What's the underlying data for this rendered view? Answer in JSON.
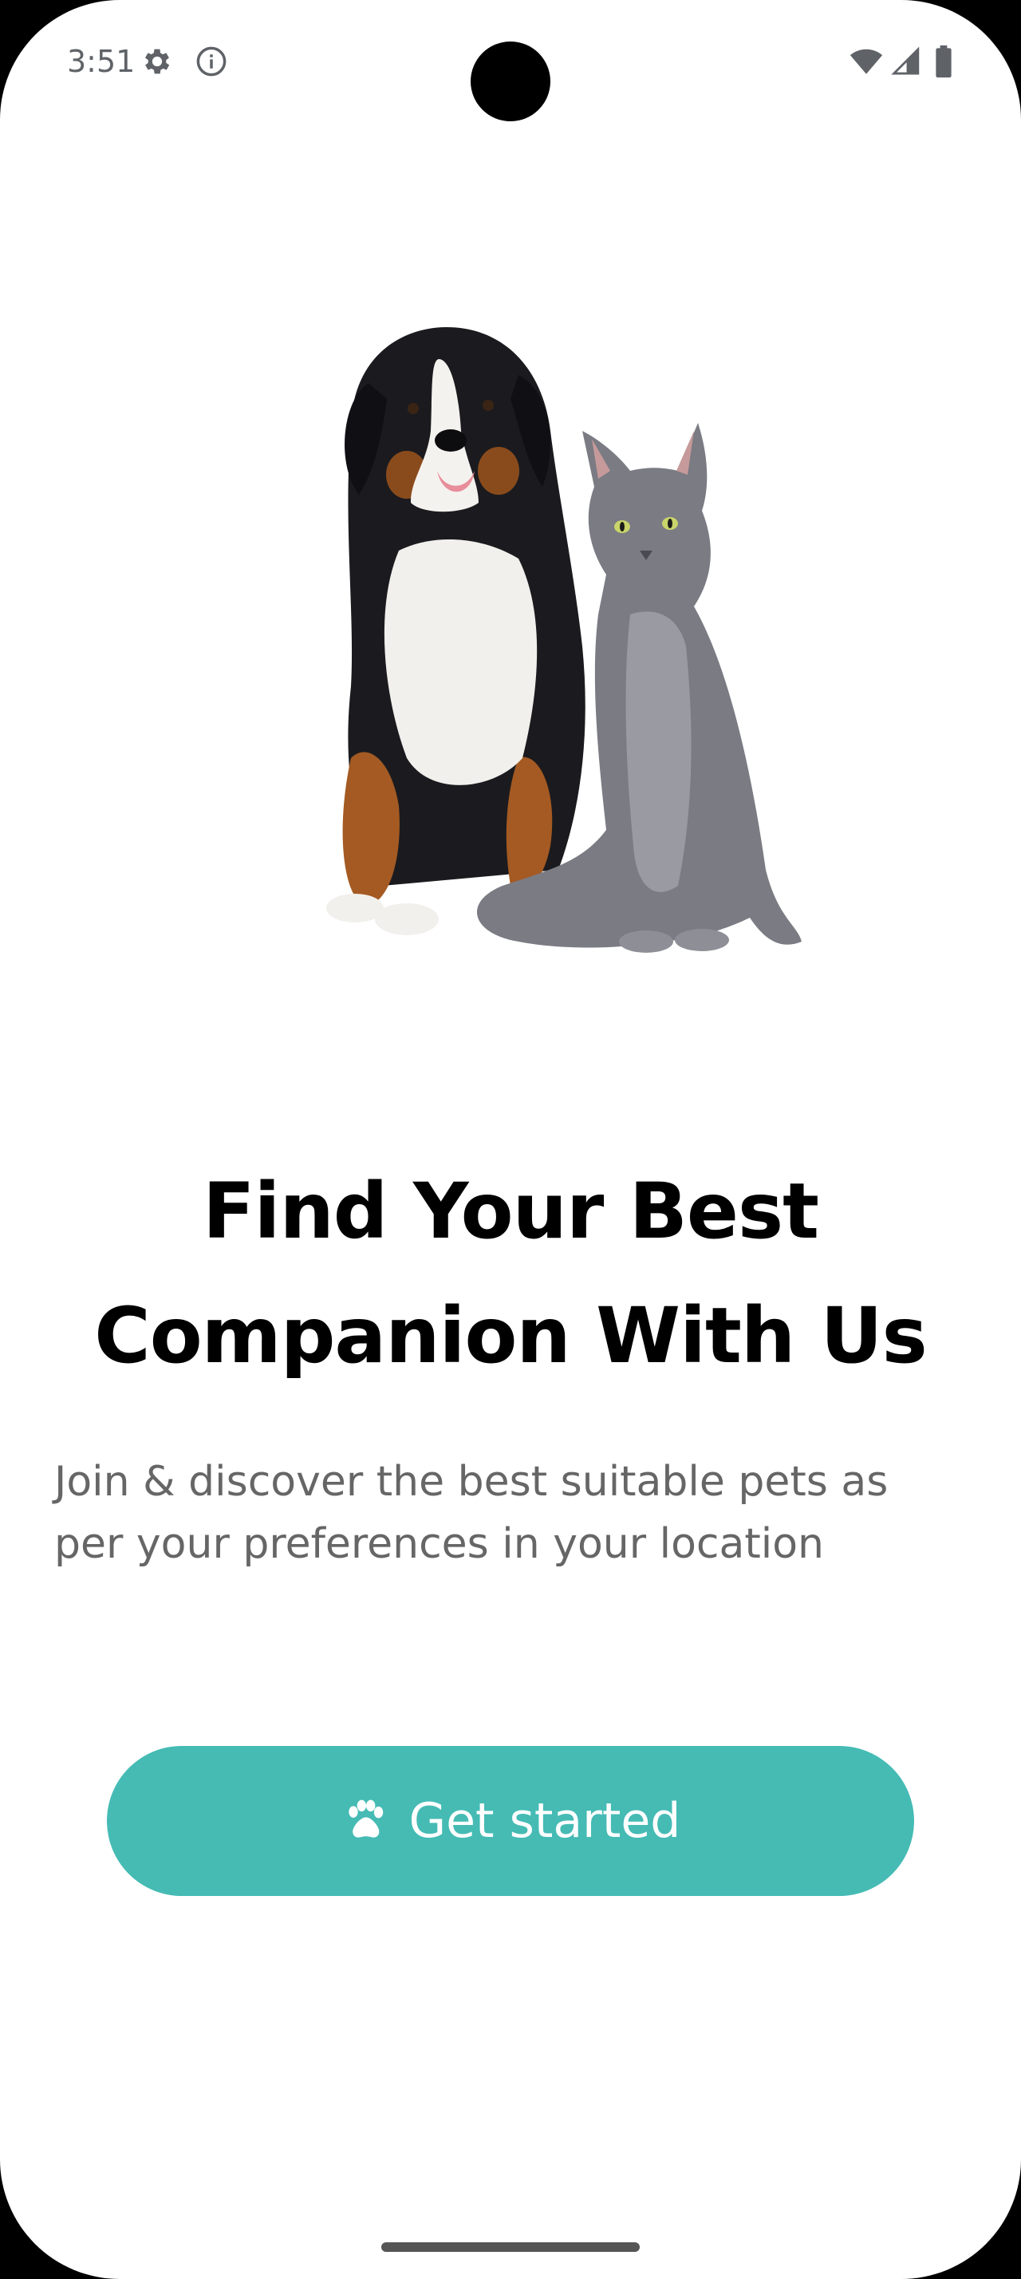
{
  "status_bar": {
    "time": "3:51",
    "icons": [
      "gear-icon",
      "info-icon",
      "wifi-icon",
      "signal-icon",
      "battery-icon"
    ]
  },
  "hero": {
    "icon": "dog-and-cat-illustration"
  },
  "onboarding": {
    "title_line1": "Find Your Best",
    "title_line2": "Companion With Us",
    "subtitle_line1": "Join & discover the best suitable pets as",
    "subtitle_line2": "per your preferences in your location"
  },
  "cta": {
    "label": "Get started",
    "icon": "paw-icon"
  },
  "colors": {
    "accent": "#45bbb4",
    "title": "#000000",
    "subtitle": "#666666",
    "background": "#ffffff"
  }
}
